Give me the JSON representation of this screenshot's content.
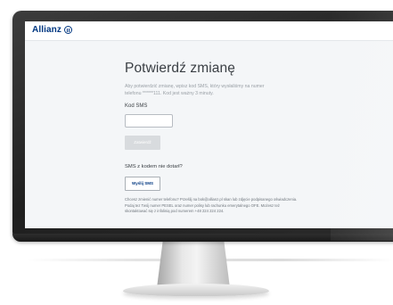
{
  "header": {
    "logo_text": "Allianz"
  },
  "main": {
    "title": "Potwierdź zmianę",
    "description": "Aby potwierdzić zmianę, wpisz kod SMS, który wysłaliśmy na numer telefonu ******111. Kod jest ważny 3 minuty.",
    "sms_label": "Kod SMS",
    "sms_input_value": "",
    "confirm_label": "Zatwierdź",
    "resend_question": "SMS z kodem nie dotarł?",
    "send_sms_label": "Wyślij SMS",
    "info_text": "Chcesz zmienić numer telefonu? Prześlij na bok@allianz.pl skan lub zdjęcie podpisanego oświadczenia. Podaj tez Twój numer PESEL oraz numer polisy lub rachunku emerytalnego OFE. Możesz też skontaktować się z infolinią pod numerem +48 224 224 224."
  },
  "colors": {
    "brand": "#003781",
    "disabled_button": "#d8dbde",
    "screen_background": "#f4f6f8"
  }
}
